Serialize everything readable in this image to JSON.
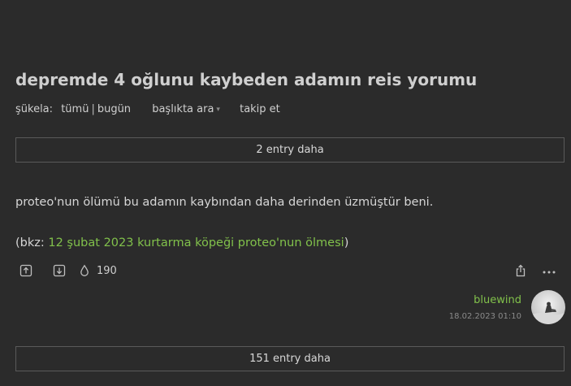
{
  "topic": {
    "title": "depremde 4 oğlunu kaybeden adamın reis yorumu"
  },
  "toolbar": {
    "sukela_label": "şükela:",
    "all_label": "tümü",
    "separator": "|",
    "today_label": "bugün",
    "search_in_topic_label": "başlıkta ara",
    "follow_label": "takip et"
  },
  "more_top": {
    "label": "2 entry daha"
  },
  "entry": {
    "text": "proteo'nun ölümü bu adamın kaybından daha derinden üzmüştür beni.",
    "bkz_prefix": "(bkz: ",
    "bkz_link": "12 şubat 2023 kurtarma köpeği proteo'nun ölmesi",
    "bkz_suffix": ")",
    "favorite_count": "190",
    "author": "bluewind",
    "date": "18.02.2023 01:10"
  },
  "icons": {
    "upvote": "arrow-up-square-icon",
    "downvote": "arrow-down-square-icon",
    "favorite": "drop-icon",
    "share": "share-icon",
    "more": "ellipsis-icon"
  },
  "colors": {
    "background": "#2b2b2b",
    "link_green": "#81c14b",
    "border": "#5a5a5a"
  },
  "more_bottom": {
    "label": "151 entry daha"
  }
}
